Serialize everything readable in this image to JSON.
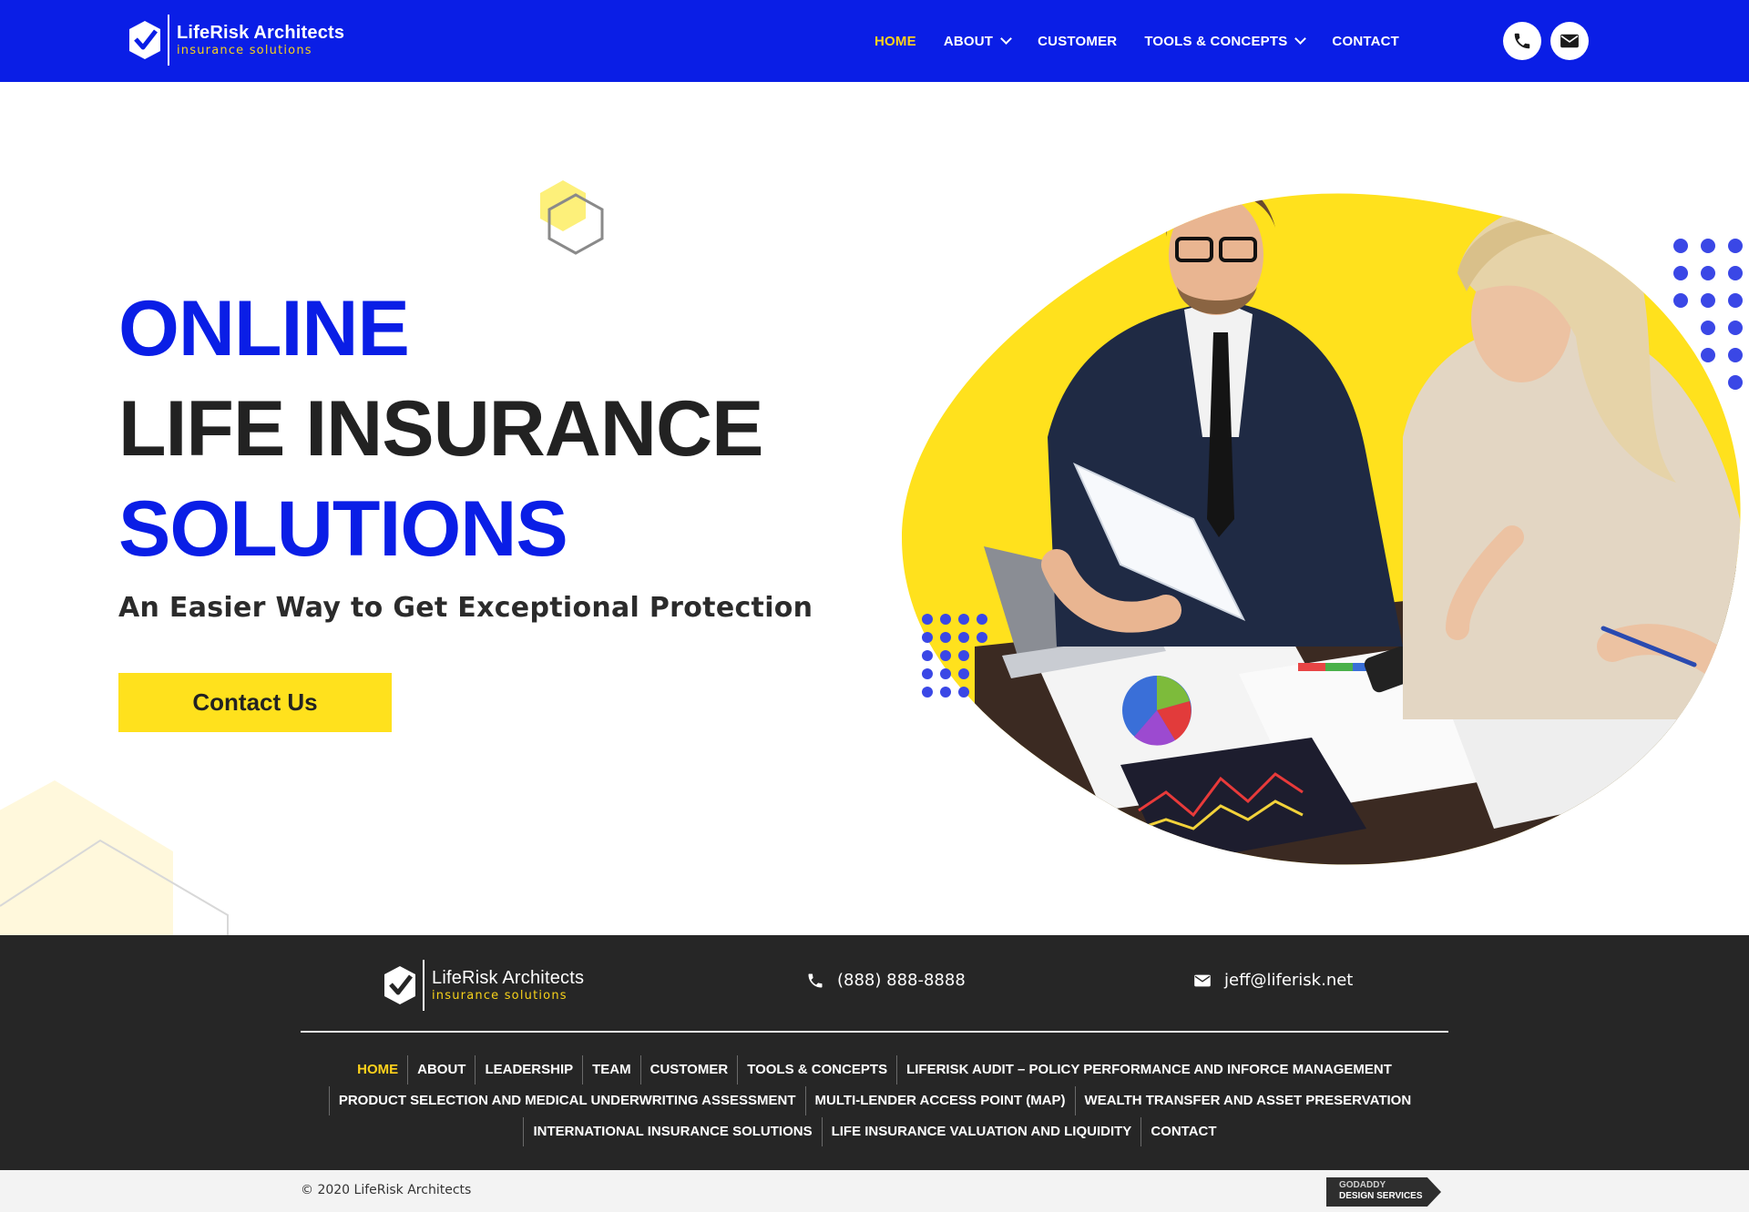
{
  "header": {
    "logo": {
      "brand": "LifeRisk Architects",
      "tagline": "insurance solutions"
    },
    "nav": [
      {
        "label": "HOME",
        "active": true,
        "dropdown": false
      },
      {
        "label": "ABOUT",
        "active": false,
        "dropdown": true
      },
      {
        "label": "CUSTOMER",
        "active": false,
        "dropdown": false
      },
      {
        "label": "TOOLS & CONCEPTS",
        "active": false,
        "dropdown": true
      },
      {
        "label": "CONTACT",
        "active": false,
        "dropdown": false
      }
    ],
    "icons": [
      "phone-icon",
      "envelope-icon"
    ]
  },
  "hero": {
    "line1": "ONLINE",
    "line2": "LIFE INSURANCE",
    "line3": "SOLUTIONS",
    "subtitle": "An Easier Way to Get Exceptional Protection",
    "cta_label": "Contact Us"
  },
  "footer": {
    "logo": {
      "brand": "LifeRisk Architects",
      "tagline": "insurance solutions"
    },
    "phone": "(888) 888-8888",
    "email": "jeff@liferisk.net",
    "links_row1": [
      "HOME",
      "ABOUT",
      "LEADERSHIP",
      "TEAM",
      "CUSTOMER",
      "TOOLS & CONCEPTS",
      "LIFERISK AUDIT – POLICY PERFORMANCE AND INFORCE MANAGEMENT"
    ],
    "links_row2": [
      "PRODUCT SELECTION AND MEDICAL UNDERWRITING ASSESSMENT",
      "MULTI-LENDER ACCESS POINT (MAP)",
      "WEALTH TRANSFER AND ASSET PRESERVATION"
    ],
    "links_row3": [
      "INTERNATIONAL INSURANCE SOLUTIONS",
      "LIFE INSURANCE VALUATION AND LIQUIDITY",
      "CONTACT"
    ]
  },
  "bottom": {
    "copyright": "© 2020 LifeRisk Architects",
    "badge_line1": "GODADDY",
    "badge_line2": "DESIGN SERVICES"
  },
  "colors": {
    "primary": "#0a1ee6",
    "accent": "#ffe11d",
    "dark": "#262626",
    "active_link": "#ffd21c"
  }
}
